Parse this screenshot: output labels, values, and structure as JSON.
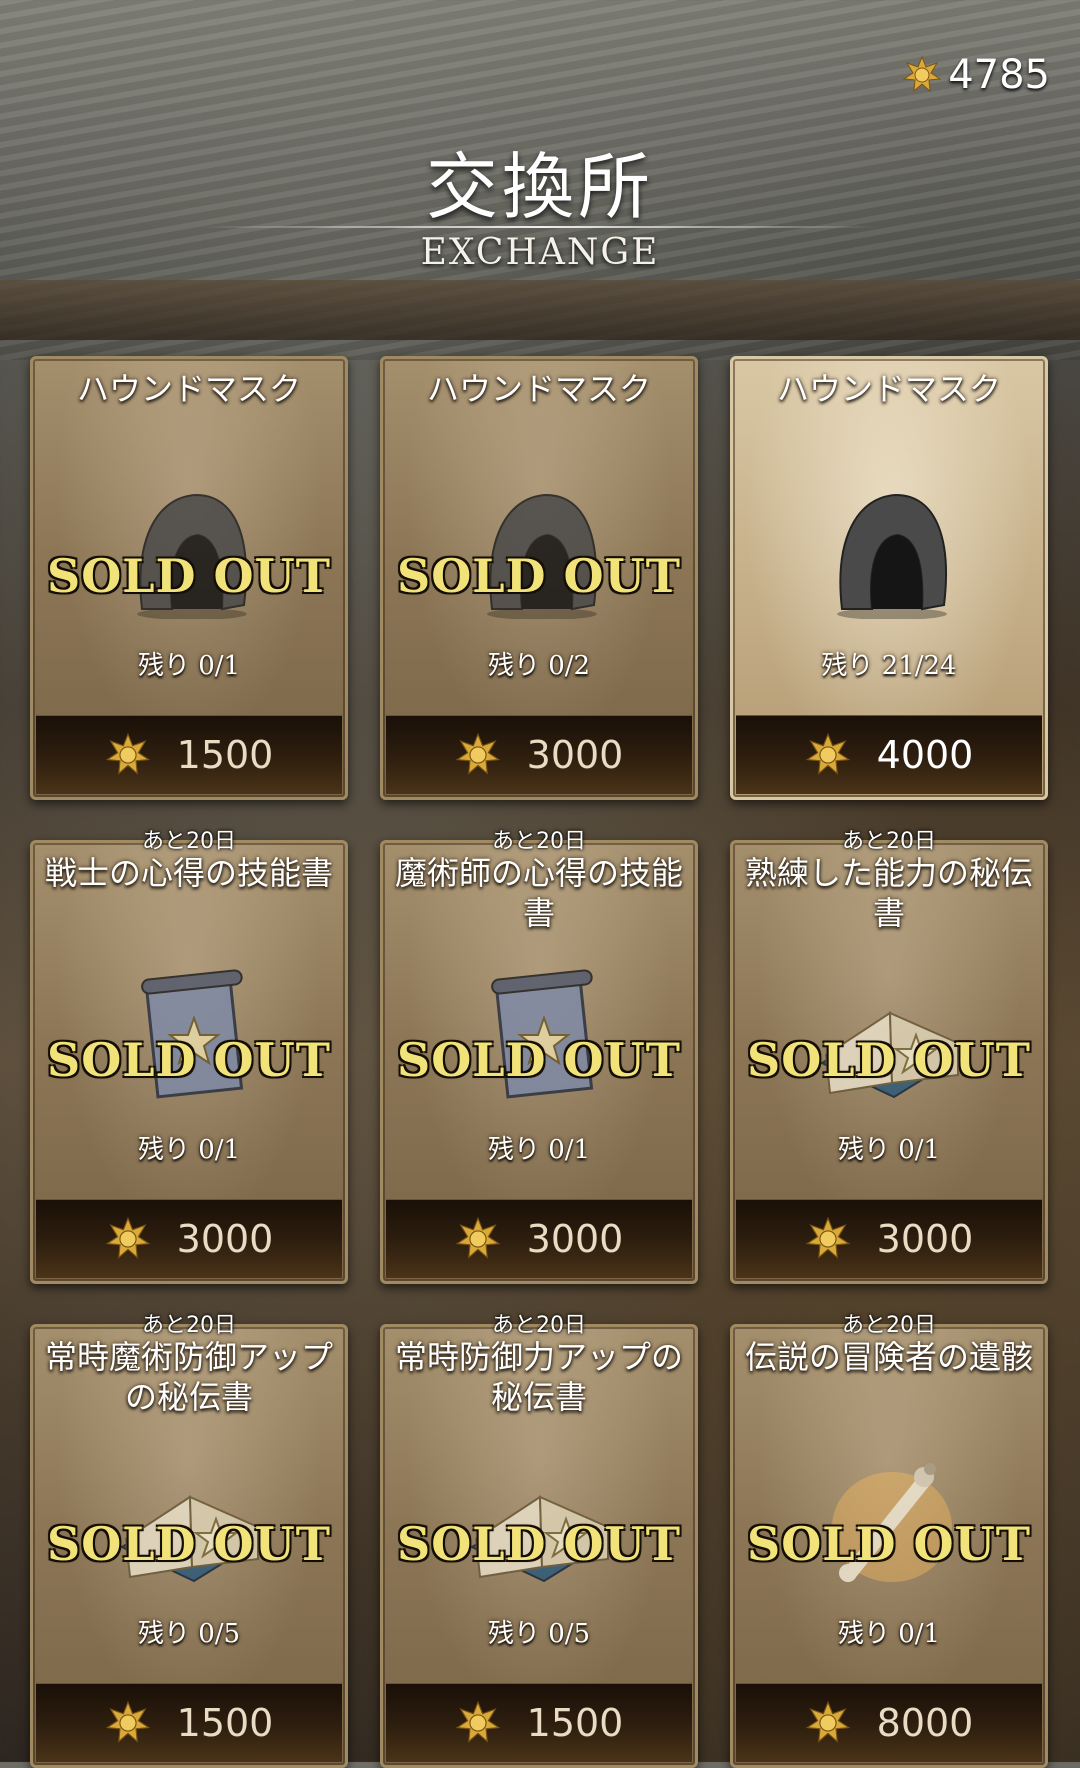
{
  "header": {
    "title": "交換所",
    "subtitle": "EXCHANGE",
    "currency_icon": "gold-medal-icon",
    "currency_amount": "4785"
  },
  "items": [
    {
      "deadline": "",
      "name": "ハウンドマスク",
      "icon": "hood-mask-icon",
      "status": "SOLD OUT",
      "remaining": "残り 0/1",
      "price": "1500"
    },
    {
      "deadline": "",
      "name": "ハウンドマスク",
      "icon": "hood-mask-icon",
      "status": "SOLD OUT",
      "remaining": "残り 0/2",
      "price": "3000"
    },
    {
      "deadline": "",
      "name": "ハウンドマスク",
      "icon": "hood-mask-icon",
      "status": "",
      "remaining": "残り 21/24",
      "price": "4000"
    },
    {
      "deadline": "あと20日",
      "name": "戦士の心得の技能書",
      "icon": "skill-scroll-icon",
      "status": "SOLD OUT",
      "remaining": "残り 0/1",
      "price": "3000"
    },
    {
      "deadline": "あと20日",
      "name": "魔術師の心得の技能書",
      "icon": "skill-scroll-icon",
      "status": "SOLD OUT",
      "remaining": "残り 0/1",
      "price": "3000"
    },
    {
      "deadline": "あと20日",
      "name": "熟練した能力の秘伝書",
      "icon": "secret-book-icon",
      "status": "SOLD OUT",
      "remaining": "残り 0/1",
      "price": "3000"
    },
    {
      "deadline": "あと20日",
      "name": "常時魔術防御アップの秘伝書",
      "icon": "secret-book-icon",
      "status": "SOLD OUT",
      "remaining": "残り 0/5",
      "price": "1500"
    },
    {
      "deadline": "あと20日",
      "name": "常時防御力アップの秘伝書",
      "icon": "secret-book-icon",
      "status": "SOLD OUT",
      "remaining": "残り 0/5",
      "price": "1500"
    },
    {
      "deadline": "あと20日",
      "name": "伝説の冒険者の遺骸",
      "icon": "bone-remains-icon",
      "status": "SOLD OUT",
      "remaining": "残り 0/1",
      "price": "8000"
    }
  ]
}
